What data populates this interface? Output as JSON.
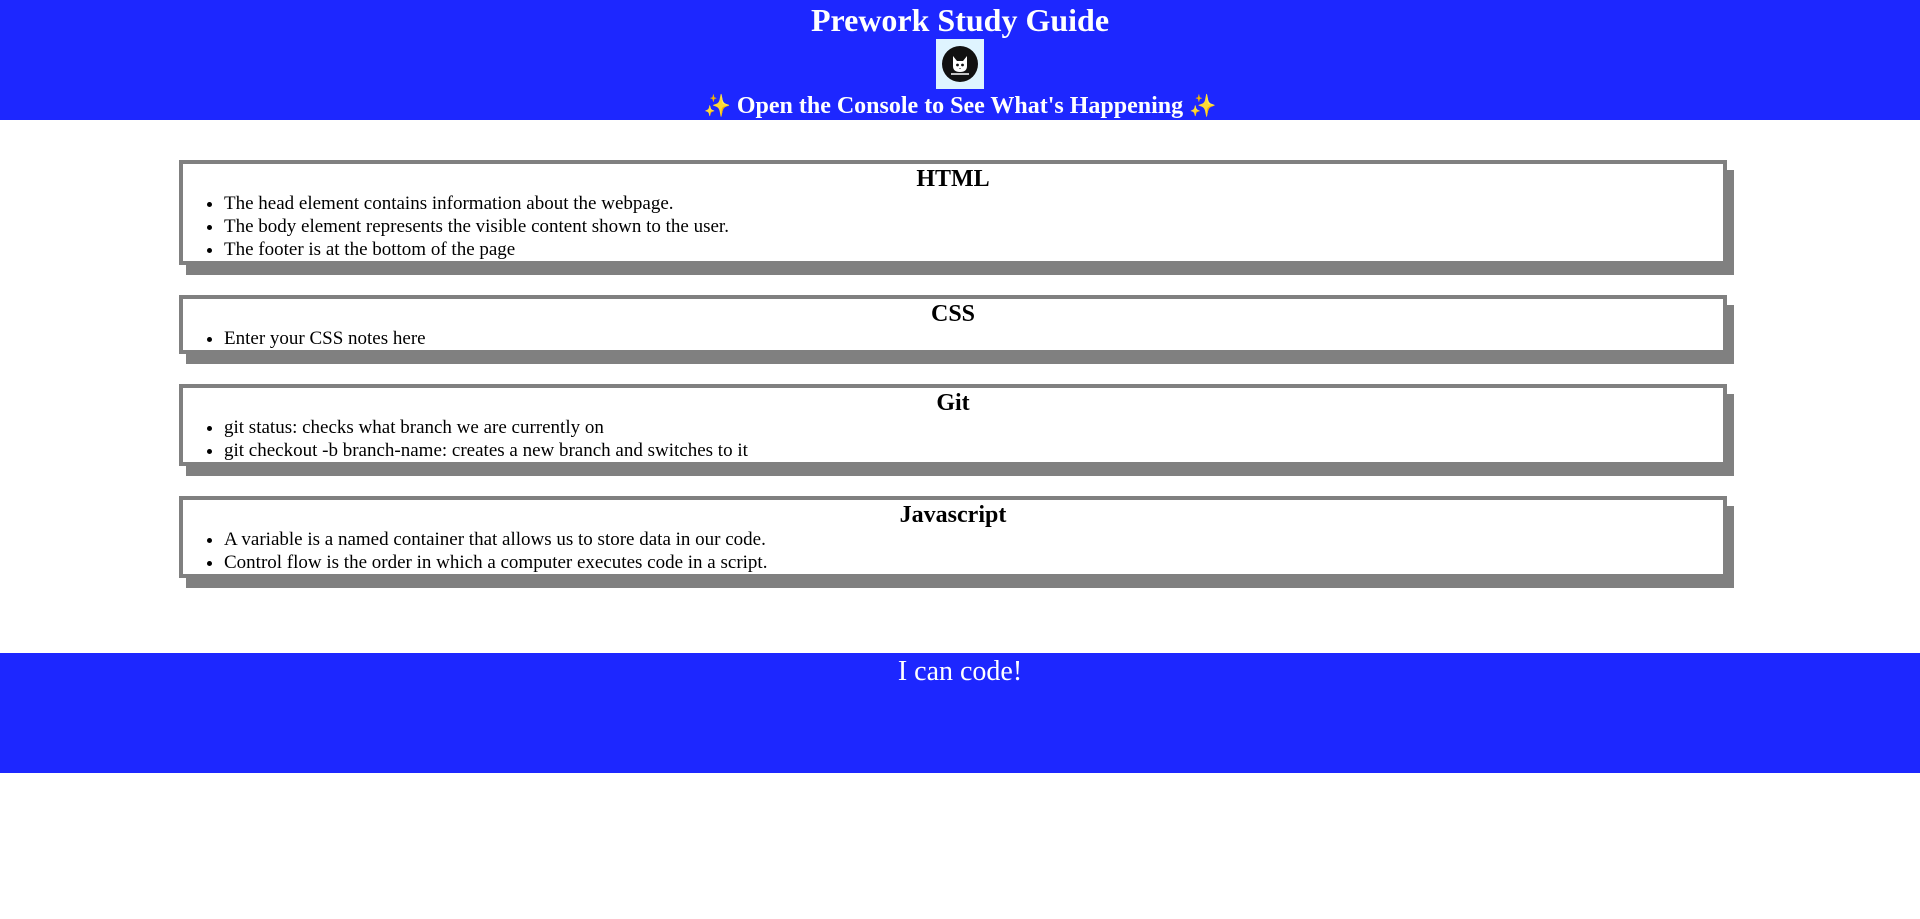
{
  "header": {
    "title": "Prework Study Guide",
    "subtitle": "Open the Console to See What's Happening",
    "sparkle_left": "✨",
    "sparkle_right": "✨",
    "logo_icon": "cat-icon"
  },
  "sections": [
    {
      "title": "HTML",
      "items": [
        "The head element contains information about the webpage.",
        "The body element represents the visible content shown to the user.",
        "The footer is at the bottom of the page"
      ]
    },
    {
      "title": "CSS",
      "items": [
        "Enter your CSS notes here"
      ]
    },
    {
      "title": "Git",
      "items": [
        "git status: checks what branch we are currently on",
        "git checkout -b branch-name: creates a new branch and switches to it"
      ]
    },
    {
      "title": "Javascript",
      "items": [
        "A variable is a named container that allows us to store data in our code.",
        "Control flow is the order in which a computer executes code in a script."
      ]
    }
  ],
  "footer": {
    "text": "I can code!"
  },
  "colors": {
    "brand_blue": "#1d27ff",
    "card_border": "#808080"
  }
}
